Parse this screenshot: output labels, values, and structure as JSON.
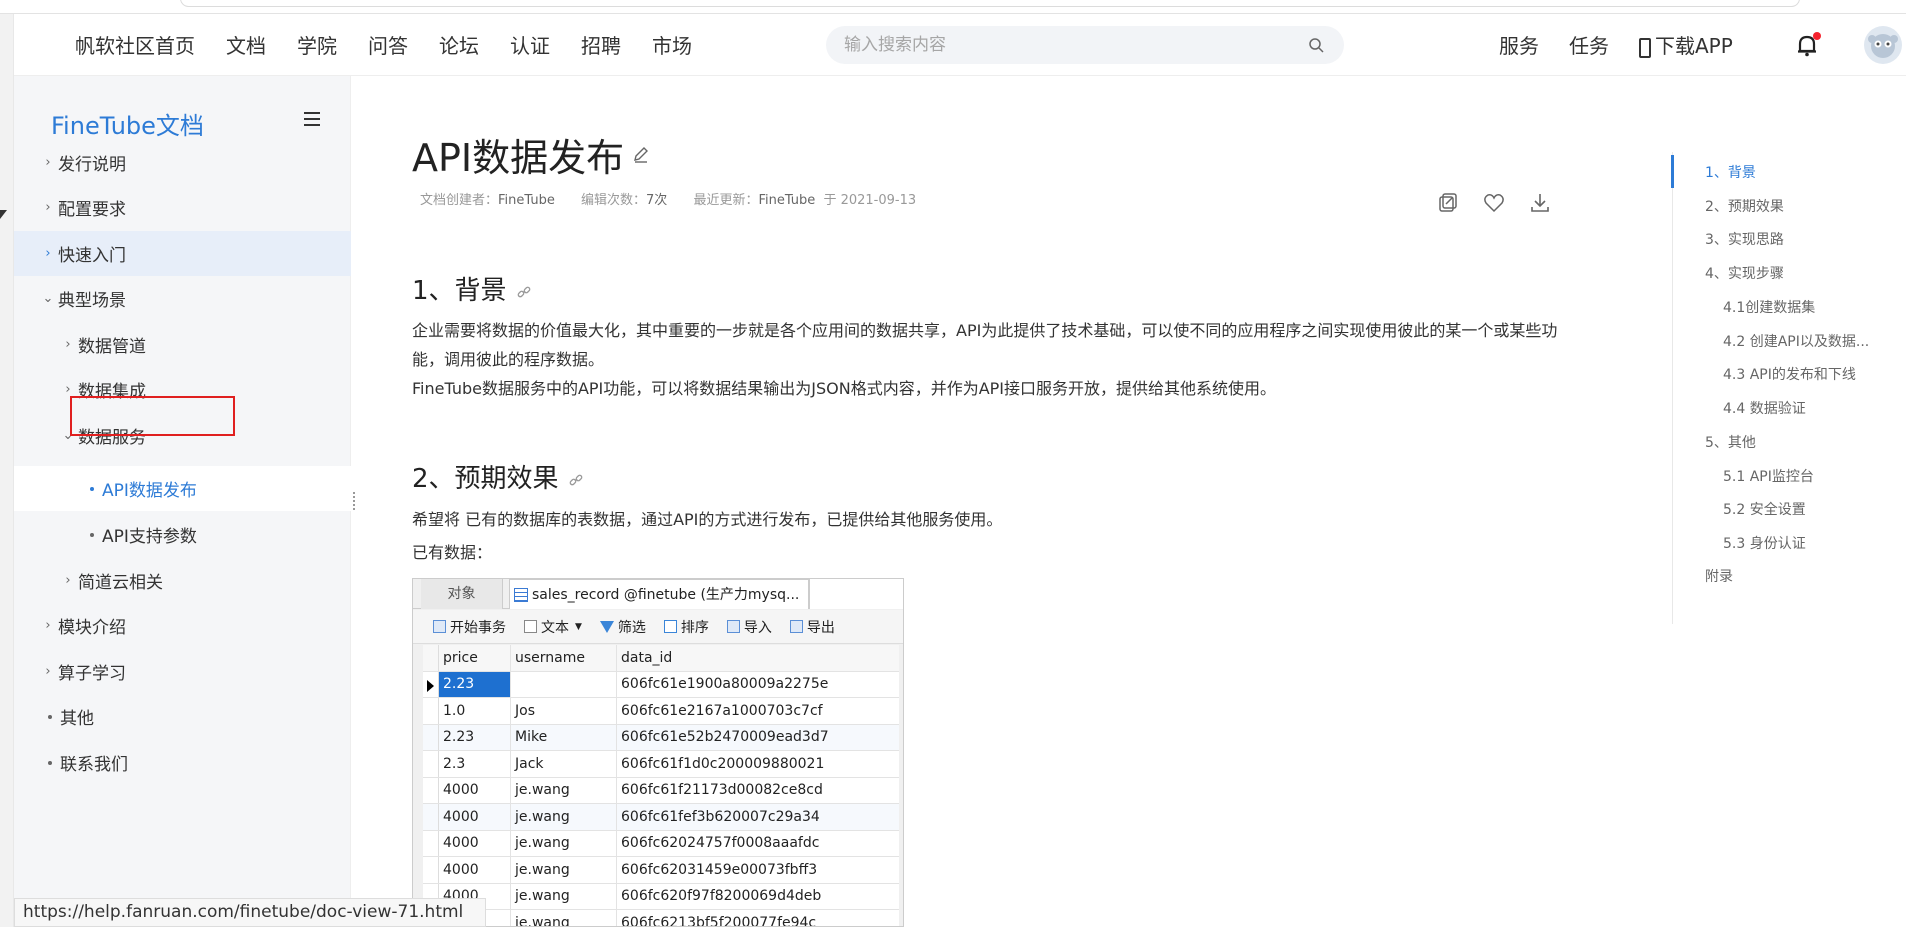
{
  "header": {
    "nav": [
      "帆软社区首页",
      "文档",
      "学院",
      "问答",
      "论坛",
      "认证",
      "招聘",
      "市场"
    ],
    "search_placeholder": "输入搜索内容",
    "service": "服务",
    "task": "任务",
    "download_app": "下载APP"
  },
  "sidebar": {
    "title": "FineTube文档",
    "items": [
      {
        "label": "发行说明",
        "icon": "chevron-right"
      },
      {
        "label": "配置要求",
        "icon": "chevron-right"
      },
      {
        "label": "快速入门",
        "icon": "chevron-right"
      },
      {
        "label": "典型场景",
        "icon": "chevron-down"
      },
      {
        "label": "数据管道",
        "icon": "chevron-right"
      },
      {
        "label": "数据集成",
        "icon": "chevron-right"
      },
      {
        "label": "数据服务",
        "icon": "chevron-down"
      },
      {
        "label": "API数据发布",
        "icon": "dot"
      },
      {
        "label": "API支持参数",
        "icon": "dot"
      },
      {
        "label": "简道云相关",
        "icon": "chevron-right"
      },
      {
        "label": "模块介绍",
        "icon": "chevron-right"
      },
      {
        "label": "算子学习",
        "icon": "chevron-right"
      },
      {
        "label": "其他",
        "icon": "dot"
      },
      {
        "label": "联系我们",
        "icon": "dot"
      }
    ]
  },
  "article": {
    "title": "API数据发布",
    "meta": {
      "creator_label": "文档创建者：",
      "creator": "FineTube",
      "edits_label": "编辑次数：",
      "edits": "7次",
      "updated_label": "最近更新：",
      "updated_by": "FineTube",
      "updated_on": "于 2021-09-13"
    },
    "section1_title": "1、背景",
    "section1_p1": "企业需要将数据的价值最大化，其中重要的一步就是各个应用间的数据共享，API为此提供了技术基础，可以使不同的应用程序之间实现使用彼此的某一个或某些功能，调用彼此的程序数据。",
    "section1_p2": "FineTube数据服务中的API功能，可以将数据结果输出为JSON格式内容，并作为API接口服务开放，提供给其他系统使用。",
    "section2_title": "2、预期效果",
    "section2_p1": "希望将 已有的数据库的表数据，通过API的方式进行发布，已提供给其他服务使用。",
    "section2_p2": "已有数据："
  },
  "db_table": {
    "tab_object": "对象",
    "tab_table": "sales_record @finetube (生产力mysq...",
    "toolbar": [
      "开始事务",
      "文本",
      "筛选",
      "排序",
      "导入",
      "导出"
    ],
    "columns": [
      "price",
      "username",
      "data_id"
    ],
    "rows": [
      [
        "2.23",
        "",
        "606fc61e1900a80009a2275e"
      ],
      [
        "1.0",
        "Jos",
        "606fc61e2167a1000703c7cf"
      ],
      [
        "2.23",
        "Mike",
        "606fc61e52b2470009ead3d7"
      ],
      [
        "2.3",
        "Jack",
        "606fc61f1d0c200009880021"
      ],
      [
        "4000",
        "je.wang",
        "606fc61f21173d00082ce8cd"
      ],
      [
        "4000",
        "je.wang",
        "606fc61fef3b620007c29a34"
      ],
      [
        "4000",
        "je.wang",
        "606fc62024757f0008aaafdc"
      ],
      [
        "4000",
        "je.wang",
        "606fc62031459e00073fbff3"
      ],
      [
        "4000",
        "je.wang",
        "606fc620f97f8200069d4deb"
      ],
      [
        "",
        "je.wang",
        "606fc6213bf5f200077fe94c"
      ]
    ]
  },
  "toc": [
    "1、背景",
    "2、预期效果",
    "3、实现思路",
    "4、实现步骤",
    "4.1创建数据集",
    "4.2 创建API以及数据...",
    "4.3 API的发布和下线",
    "4.4 数据验证",
    "5、其他",
    "5.1 API监控台",
    "5.2 安全设置",
    "5.3 身份认证",
    "附录"
  ],
  "status_url": "https://help.fanruan.com/finetube/doc-view-71.html",
  "colors": {
    "accent": "#2d7bd6",
    "highlight_box": "#e01f1f"
  }
}
